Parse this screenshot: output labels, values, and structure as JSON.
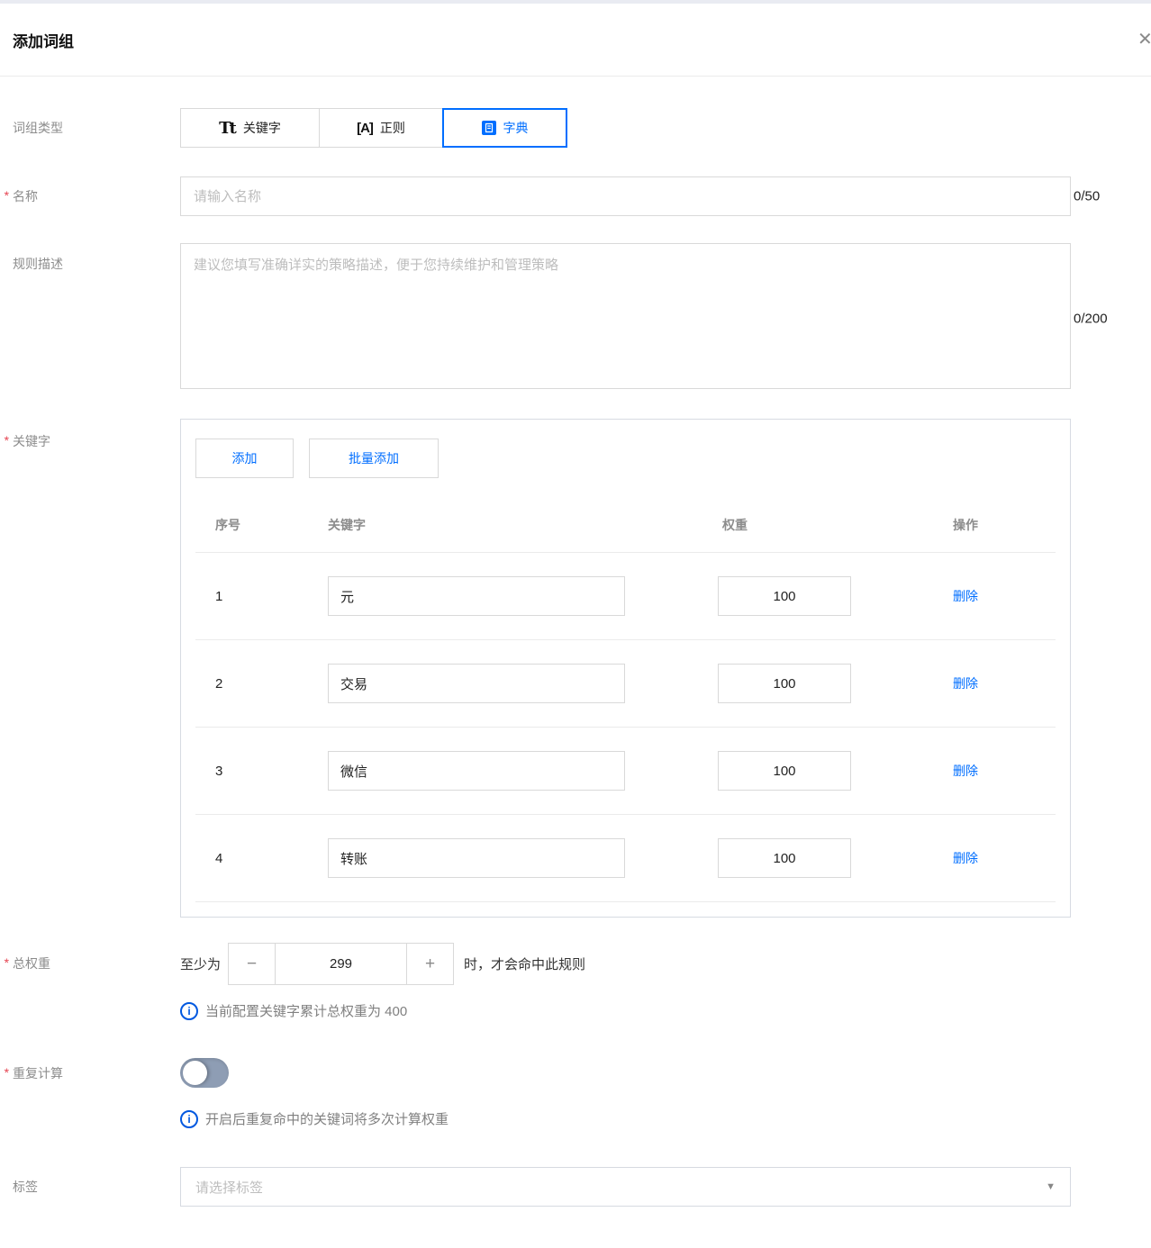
{
  "title": "添加词组",
  "icons": {
    "close": "✕",
    "dropdown": "▼",
    "minus": "−",
    "plus": "+",
    "info": "i",
    "text_type": "Tt",
    "regex_type": "[A]"
  },
  "colors": {
    "accent": "#006eff",
    "required_mark": "#e64552",
    "toggle_off_track": "#8e9db4"
  },
  "type_row": {
    "label": "词组类型",
    "options": [
      {
        "label": "关键字"
      },
      {
        "label": "正则"
      },
      {
        "label": "字典"
      }
    ],
    "selected": "字典"
  },
  "name_row": {
    "label": "名称",
    "required": "*",
    "placeholder": "请输入名称",
    "counter": "0/50"
  },
  "desc_row": {
    "label": "规则描述",
    "placeholder": "建议您填写准确详实的策略描述，便于您持续维护和管理策略",
    "counter": "0/200"
  },
  "keywords_row": {
    "label": "关键字",
    "required": "*",
    "add_button": "添加",
    "batch_add_button": "批量添加",
    "table": {
      "headers": [
        "序号",
        "关键字",
        "权重",
        "操作"
      ],
      "rows": [
        {
          "no": "1",
          "keyword": "元",
          "weight": "100",
          "action": "删除"
        },
        {
          "no": "2",
          "keyword": "交易",
          "weight": "100",
          "action": "删除"
        },
        {
          "no": "3",
          "keyword": "微信",
          "weight": "100",
          "action": "删除"
        },
        {
          "no": "4",
          "keyword": "转账",
          "weight": "100",
          "action": "删除"
        }
      ]
    }
  },
  "total_weight_row": {
    "label": "总权重",
    "required": "*",
    "prefix": "至少为",
    "value": "299",
    "suffix": "时，才会命中此规则",
    "info": "当前配置关键字累计总权重为 400"
  },
  "repeat_row": {
    "label": "重复计算",
    "required": "*",
    "state": "off",
    "info": "开启后重复命中的关键词将多次计算权重"
  },
  "tag_row": {
    "label": "标签",
    "placeholder": "请选择标签"
  }
}
